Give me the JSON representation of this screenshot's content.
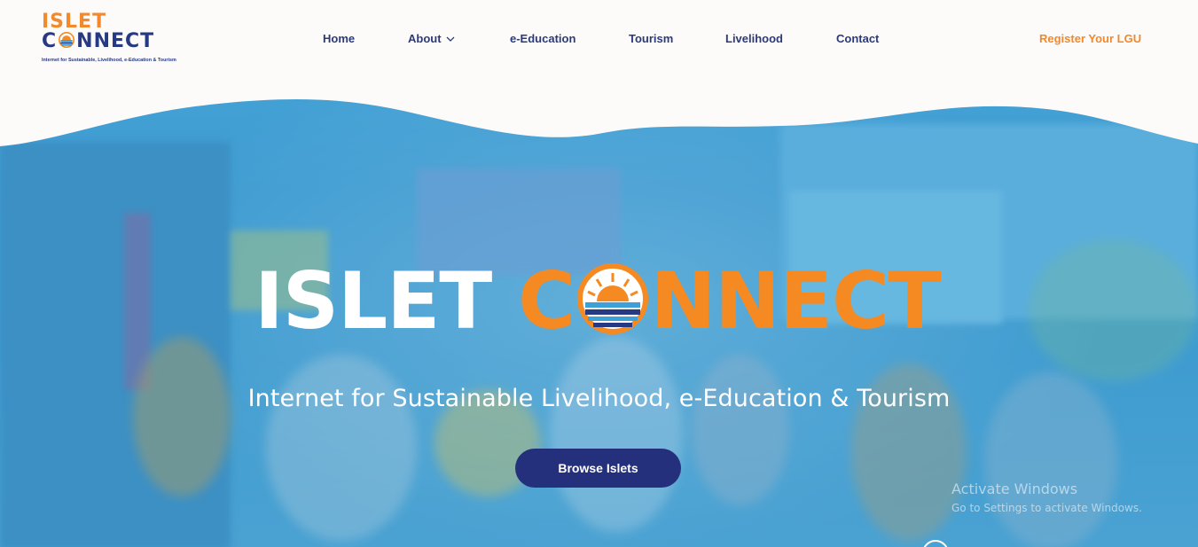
{
  "brand": {
    "logo_line1": "ISLET",
    "logo_line2_prefix": "C",
    "logo_line2_suffix": "NNECT",
    "tagline": "Internet for Sustainable, Livelihood, e-Education & Tourism"
  },
  "nav": {
    "items": [
      {
        "label": "Home"
      },
      {
        "label": "About"
      },
      {
        "label": "e-Education"
      },
      {
        "label": "Tourism"
      },
      {
        "label": "Livelihood"
      },
      {
        "label": "Contact"
      }
    ],
    "register_label": "Register Your LGU",
    "about_icon": "chevron-down-icon"
  },
  "hero": {
    "title_word1": "ISLET",
    "title_c": "C",
    "title_rest": "NNECT",
    "subtitle": "Internet for Sustainable Livelihood, e-Education & Tourism",
    "browse_label": "Browse Islets"
  },
  "os_watermark": {
    "line1": "Activate Windows",
    "line2": "Go to Settings to activate Windows."
  },
  "colors": {
    "brand_orange": "#f58a22",
    "brand_navy": "#25307d",
    "hero_blue": "#3f9cd0",
    "header_bg": "#fdfafa"
  }
}
